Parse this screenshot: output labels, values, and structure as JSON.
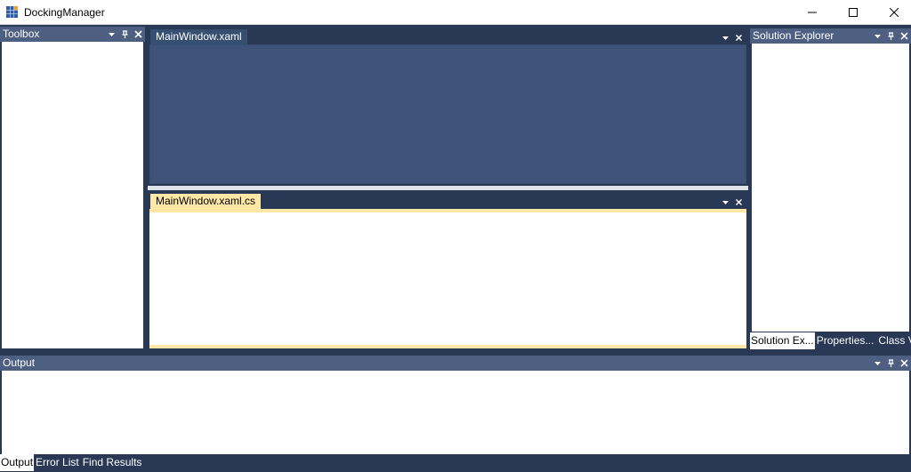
{
  "window": {
    "title": "DockingManager",
    "icon": "app-grid-icon",
    "buttons": [
      "minimize-icon",
      "maximize-icon",
      "close-icon"
    ]
  },
  "toolbox": {
    "title": "Toolbox"
  },
  "documents": {
    "top": {
      "tab_label": "MainWindow.xaml",
      "state": "inactive"
    },
    "bottom": {
      "tab_label": "MainWindow.xaml.cs",
      "state": "active"
    }
  },
  "solution_explorer": {
    "title": "Solution Explorer",
    "tabs": [
      {
        "label": "Solution Ex...",
        "active": true
      },
      {
        "label": "Properties...",
        "active": false
      },
      {
        "label": "Class View",
        "active": false
      }
    ]
  },
  "output": {
    "title": "Output",
    "tabs": [
      {
        "label": "Output",
        "active": true
      },
      {
        "label": "Error List",
        "active": false
      },
      {
        "label": "Find Results",
        "active": false
      }
    ]
  },
  "colors": {
    "frame": "#293955",
    "header": "#4d6082",
    "doc_area": "#3e5377",
    "active_tab": "#ffe8a6",
    "panel_body": "#ffffff"
  }
}
